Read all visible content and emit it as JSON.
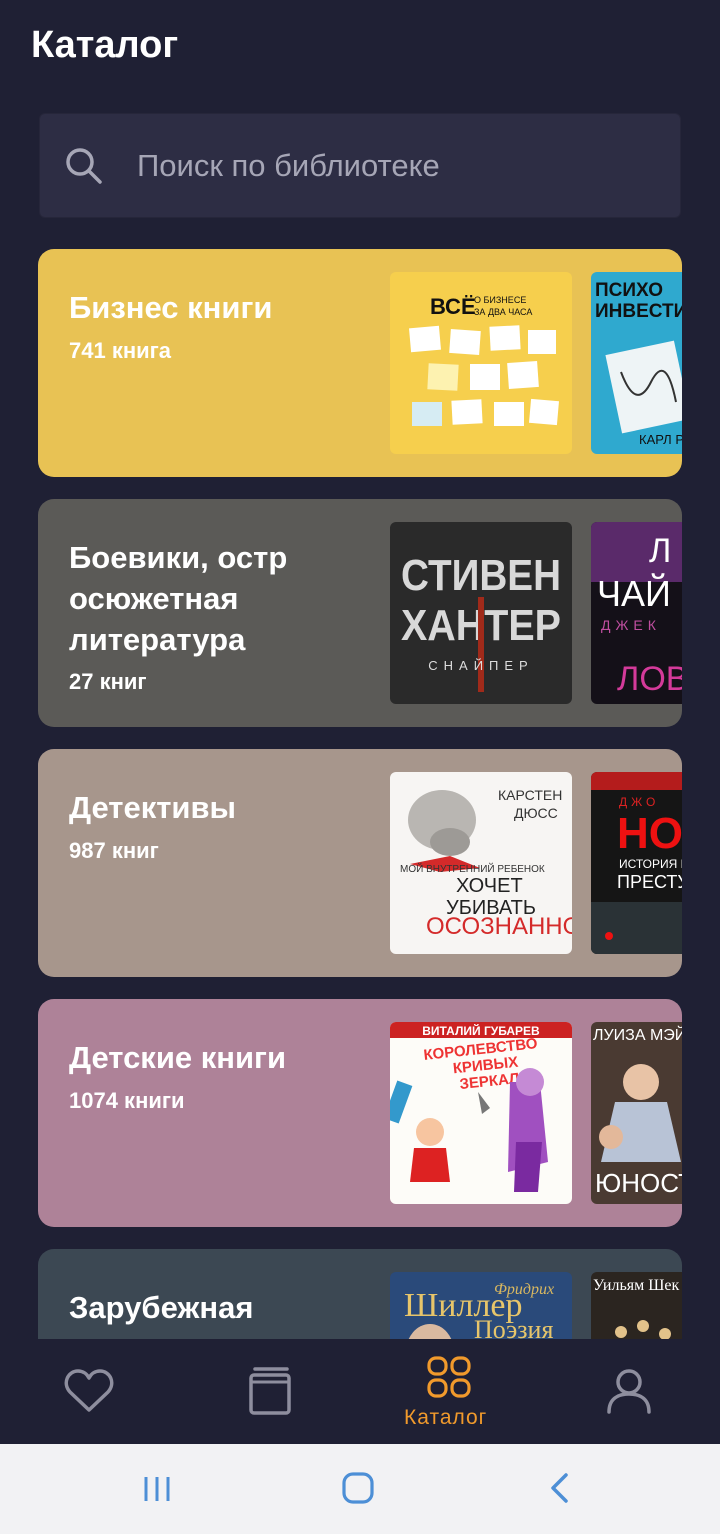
{
  "header": {
    "title": "Каталог"
  },
  "search": {
    "placeholder": "Поиск по библиотеке",
    "icon": "search-icon"
  },
  "categories": [
    {
      "title": "Бизнес книги",
      "count": "741 книга",
      "color": "#e8c254",
      "covers": [
        {
          "title": "ВСЁ",
          "subtitle": "О БИЗНЕСЕ ЗА ДВА ЧАСА"
        },
        {
          "title": "ПСИХО ИНВЕСТИ",
          "subtitle": "КАРЛ Р"
        }
      ]
    },
    {
      "title": "Боевики, острosюжетная литература",
      "title_lines": [
        "Боевики, остр",
        "осюжетная",
        "литература"
      ],
      "count": "27 книг",
      "color": "#5b5a57",
      "covers": [
        {
          "title": "СТИВЕН ХАНТЕР",
          "subtitle": "СНАЙПЕР"
        },
        {
          "title": "Л ЧАЙ",
          "subtitle": "ДЖЕК",
          "extra": "ЛОВУ"
        }
      ]
    },
    {
      "title": "Детективы",
      "count": "987 книг",
      "color": "#a7968c",
      "covers": [
        {
          "author": "КАРСТЕН ДЮСС",
          "title": "ХОЧЕТ УБИВАТЬ",
          "subtitle": "ОСОЗНАННО",
          "extra": "МОЙ ВНУТРЕННИЙ РЕБЕНОК"
        },
        {
          "author": "ДЖО",
          "title": "НО",
          "subtitle": "ИСТОРИЯ НА",
          "extra": "ПРЕСТУП"
        }
      ]
    },
    {
      "title": "Детские книги",
      "count": "1074 книги",
      "color": "#ae8298",
      "covers": [
        {
          "author": "ВИТАЛИЙ ГУБАРЕВ",
          "title": "КОРОЛЕВСТВО КРИВЫХ ЗЕРКАЛ"
        },
        {
          "author": "ЛУИЗА МЭЙ О",
          "title": "ЮНОСТ"
        }
      ]
    },
    {
      "title": "Зарубежная",
      "count": "",
      "color": "#3c4853",
      "covers": [
        {
          "author": "Фридрих",
          "title": "Шиллер",
          "subtitle": "Поэзия"
        },
        {
          "author": "Уильям Шек",
          "title": ""
        }
      ]
    }
  ],
  "nav": {
    "items": [
      {
        "name": "favorites",
        "icon": "heart-icon",
        "label": ""
      },
      {
        "name": "library",
        "icon": "book-icon",
        "label": ""
      },
      {
        "name": "catalog",
        "icon": "grid-icon",
        "label": "Каталог",
        "active": true
      },
      {
        "name": "profile",
        "icon": "user-icon",
        "label": ""
      }
    ],
    "active_color": "#f19a2c",
    "inactive_color": "#8e8e9e"
  },
  "system_nav": {
    "items": [
      "recent-apps-icon",
      "home-icon",
      "back-icon"
    ]
  }
}
